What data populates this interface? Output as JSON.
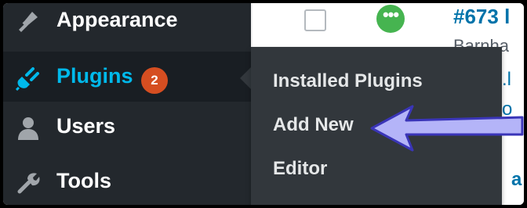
{
  "sidebar": {
    "items": [
      {
        "label": "Appearance",
        "icon": "paintbrush-icon"
      },
      {
        "label": "Plugins",
        "icon": "plug-icon",
        "badge": "2",
        "current": true
      },
      {
        "label": "Users",
        "icon": "user-icon"
      },
      {
        "label": "Tools",
        "icon": "wrench-icon"
      }
    ]
  },
  "submenu": {
    "items": [
      {
        "label": "Installed Plugins"
      },
      {
        "label": "Add New",
        "highlighted_by_arrow": true
      },
      {
        "label": "Editor"
      }
    ]
  },
  "content": {
    "ticket_number": "#673 l",
    "ticket_author": "Barnha",
    "link_fragment_1": "s.l",
    "link_fragment_2": "co",
    "link_fragment_3": "a"
  },
  "colors": {
    "sidebar_bg": "#23282d",
    "current_item_bg": "#191e23",
    "current_item_text": "#00b9eb",
    "submenu_bg": "#32373c",
    "badge_bg": "#d54e21",
    "link_blue": "#0073aa",
    "status_green": "#46b450",
    "arrow_fill": "#b4b4f8",
    "arrow_stroke": "#3a35b8"
  }
}
